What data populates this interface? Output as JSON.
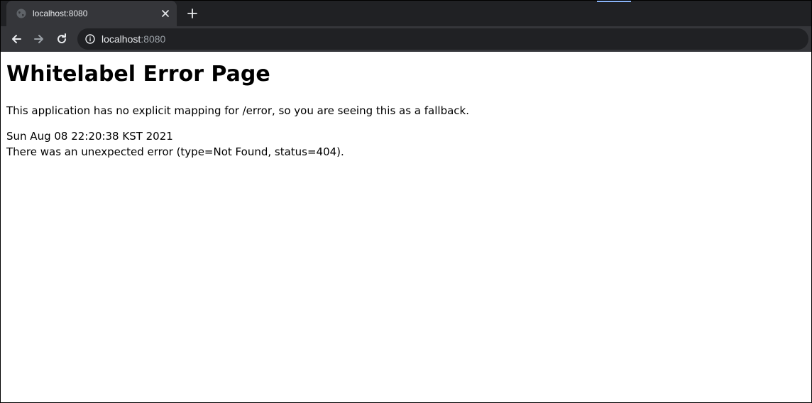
{
  "browser": {
    "tab": {
      "title": "localhost:8080",
      "favicon": "globe-icon",
      "close_icon": "close-icon"
    },
    "new_tab_icon": "plus-icon",
    "toolbar": {
      "back_icon": "arrow-left-icon",
      "forward_icon": "arrow-right-icon",
      "reload_icon": "reload-icon",
      "info_icon": "info-icon"
    },
    "address": {
      "host": "localhost",
      "port": ":8080"
    },
    "colors": {
      "tabstrip": "#202124",
      "toolbar": "#35363a",
      "omnibox": "#202124",
      "text": "#e8eaed",
      "dim_text": "#9aa0a6"
    }
  },
  "page": {
    "title": "Whitelabel Error Page",
    "message": "This application has no explicit mapping for /error, so you are seeing this as a fallback.",
    "timestamp": "Sun Aug 08 22:20:38 KST 2021",
    "error": "There was an unexpected error (type=Not Found, status=404)."
  }
}
